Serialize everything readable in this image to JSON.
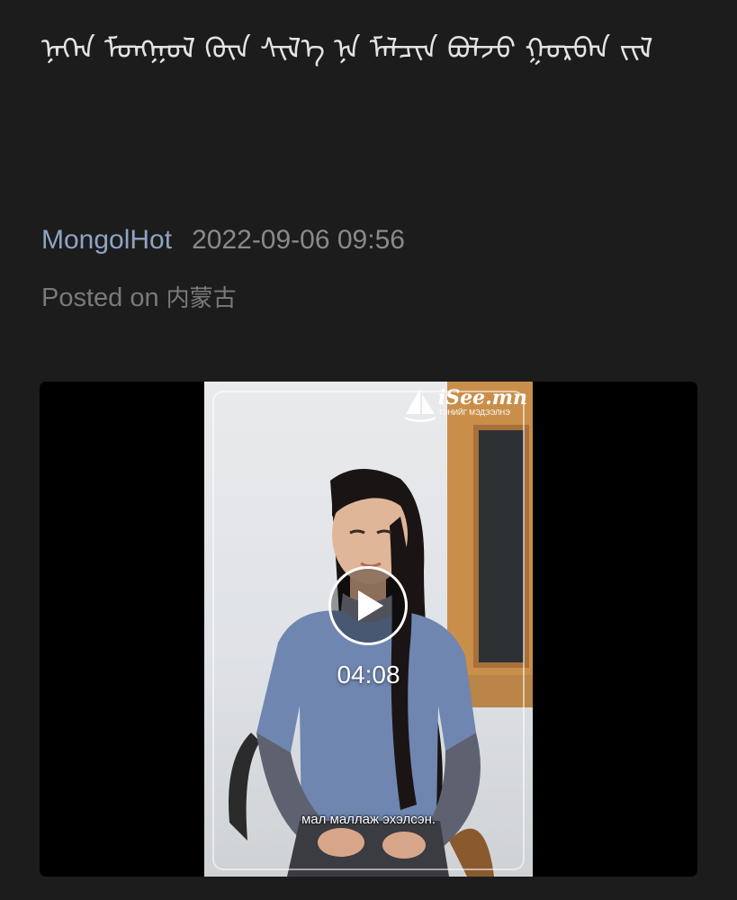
{
  "post": {
    "title": "ᠨᠡᠭᠡᠨ ᠮᠣᠩᠭᠣᠯ ᠬᠦᠨ ᠰᠢᠯ᠎ᠡ ᠨᠡ ᠮᠠᠯᠴᠢᠨ ᠪᠣᠯᠵᠤ ᠭᠣᠷᠪᠠᠨ ᠵᠢᠯ",
    "author": "MongolHot",
    "datetime": "2022-09-06 09:56",
    "posted_prefix": "Posted on",
    "posted_place": "内蒙古"
  },
  "video": {
    "watermark_name": "iSee.mn",
    "watermark_tagline": "ТЭНИЙГ МЭДЭЭЛНЭ",
    "duration": "04:08",
    "subtitle": "мал маллаж эхэлсэн.",
    "play_icon": "play-icon",
    "colors": {
      "background": "#000000",
      "shirt": "#6f86b0",
      "hair": "#1a1414",
      "window_frame": "#a8703a"
    }
  },
  "page": {
    "background": "#1c1c1d",
    "title_color": "#e4e4e4",
    "author_color": "#8fa4c2",
    "meta_color": "#8a8a8a"
  }
}
